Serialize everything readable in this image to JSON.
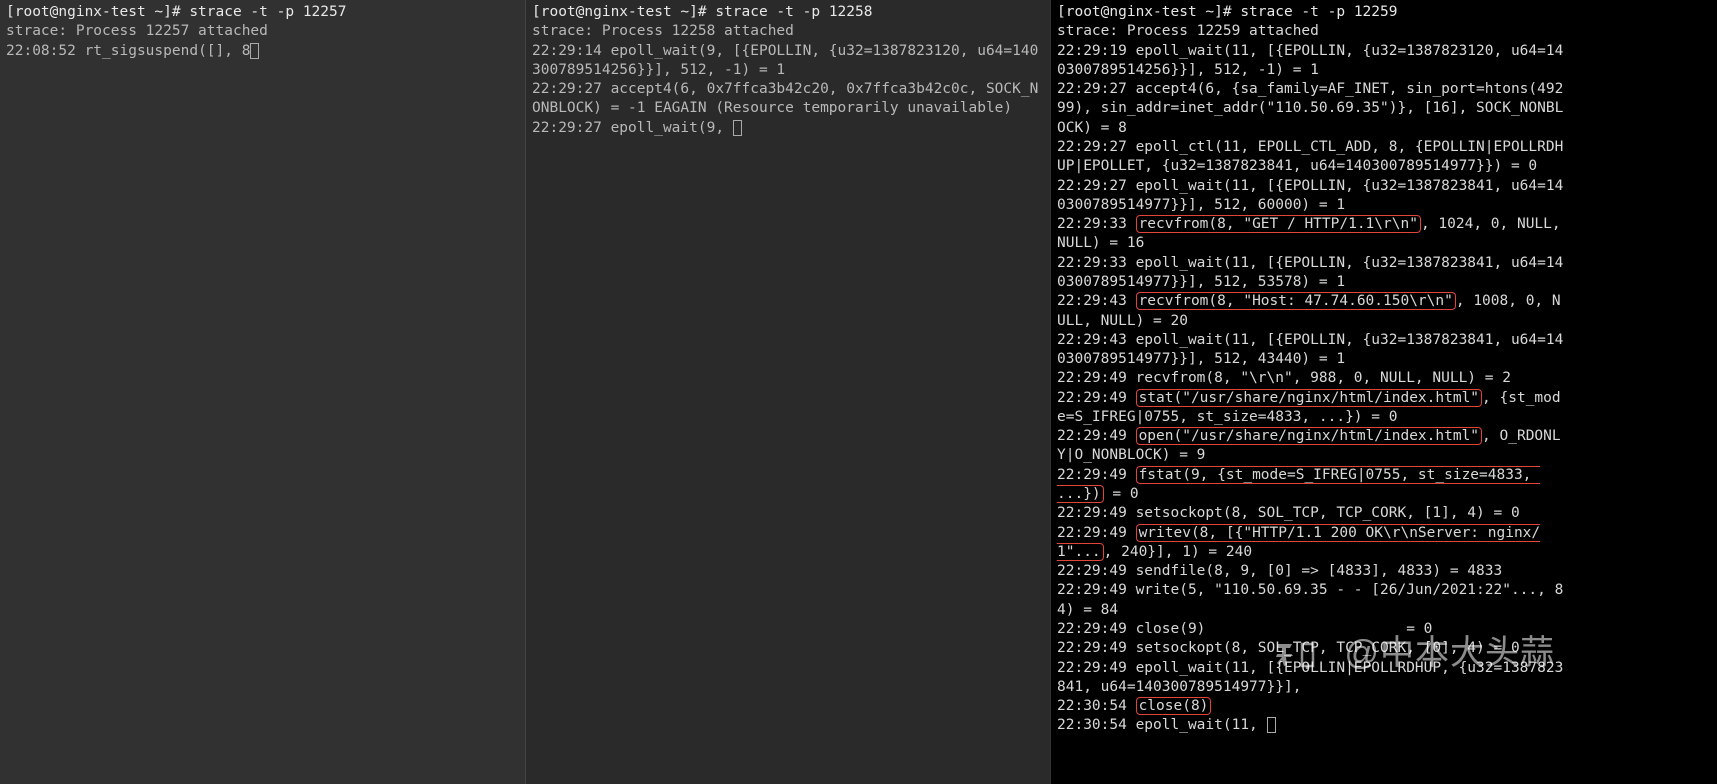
{
  "pane1": {
    "prompt_host": "[root@nginx-test ~]# ",
    "command": "strace -t -p 12257",
    "attach_msg": "strace: Process 12257 attached",
    "l1_time": "22:08:52 ",
    "l1_text": "rt_sigsuspend([], 8"
  },
  "pane2": {
    "prompt_host": "[root@nginx-test ~]# ",
    "command": "strace -t -p 12258",
    "attach_msg": "strace: Process 12258 attached",
    "l1": "22:29:14 epoll_wait(9, [{EPOLLIN, {u32=1387823120, u64=140300789514256}}], 512, -1) = 1",
    "l2": "22:29:27 accept4(6, 0x7ffca3b42c20, 0x7ffca3b42c0c, SOCK_NONBLOCK) = -1 EAGAIN (Resource temporarily unavailable)",
    "l3": "22:29:27 epoll_wait(9, "
  },
  "pane3": {
    "prompt_host": "[root@nginx-test ~]# ",
    "command": "strace -t -p 12259",
    "attach_msg": "strace: Process 12259 attached",
    "l1": "22:29:19 epoll_wait(11, [{EPOLLIN, {u32=1387823120, u64=140300789514256}}], 512, -1) = 1",
    "l2": "22:29:27 accept4(6, {sa_family=AF_INET, sin_port=htons(49299), sin_addr=inet_addr(\"110.50.69.35\")}, [16], SOCK_NONBLOCK) = 8",
    "l3": "22:29:27 epoll_ctl(11, EPOLL_CTL_ADD, 8, {EPOLLIN|EPOLLRDHUP|EPOLLET, {u32=1387823841, u64=140300789514977}}) = 0",
    "l4": "22:29:27 epoll_wait(11, [{EPOLLIN, {u32=1387823841, u64=140300789514977}}], 512, 60000) = 1",
    "l5a": "22:29:33 ",
    "l5h": "recvfrom(8, \"GET / HTTP/1.1\\r\\n\"",
    "l5b": ", 1024, 0, NULL, NULL) = 16",
    "l6": "22:29:33 epoll_wait(11, [{EPOLLIN, {u32=1387823841, u64=140300789514977}}], 512, 53578) = 1",
    "l7a": "22:29:43 ",
    "l7h": "recvfrom(8, \"Host: 47.74.60.150\\r\\n\"",
    "l7b": ", 1008, 0, NULL, NULL) = 20",
    "l8": "22:29:43 epoll_wait(11, [{EPOLLIN, {u32=1387823841, u64=140300789514977}}], 512, 43440) = 1",
    "l9": "22:29:49 recvfrom(8, \"\\r\\n\", 988, 0, NULL, NULL) = 2",
    "l10a": "22:29:49 ",
    "l10h": "stat(\"/usr/share/nginx/html/index.html\"",
    "l10b": ", {st_mode=S_IFREG|0755, st_size=4833, ...}) = 0",
    "l11a": "22:29:49 ",
    "l11h": "open(\"/usr/share/nginx/html/index.html\"",
    "l11b": ", O_RDONLY|O_NONBLOCK) = 9",
    "l12a": "22:29:49 ",
    "l12h": "fstat(9, {st_mode=S_IFREG|0755, st_size=4833, ...})",
    "l12b": " = 0",
    "l13": "22:29:49 setsockopt(8, SOL_TCP, TCP_CORK, [1], 4) = 0",
    "l14a": "22:29:49 ",
    "l14h": "writev(8, [{\"HTTP/1.1 200 OK\\r\\nServer: nginx/1\"...",
    "l14b": ", 240}], 1) = 240",
    "l15": "22:29:49 sendfile(8, 9, [0] => [4833], 4833) = 4833",
    "l16": "22:29:49 write(5, \"110.50.69.35 - - [26/Jun/2021:22\"..., 84) = 84",
    "l17": "22:29:49 close(9)                       = 0",
    "l18": "22:29:49 setsockopt(8, SOL_TCP, TCP_CORK, [0], 4) = 0",
    "l19": "22:29:49 epoll_wait(11, [{EPOLLIN|EPOLLRDHUP, {u32=1387823841, u64=140300789514977}}],",
    "l20a": "22:30:54 ",
    "l20h": "close(8)",
    "l21": "22:30:54 epoll_wait(11, "
  },
  "watermark_text": "@中本大头蒜"
}
